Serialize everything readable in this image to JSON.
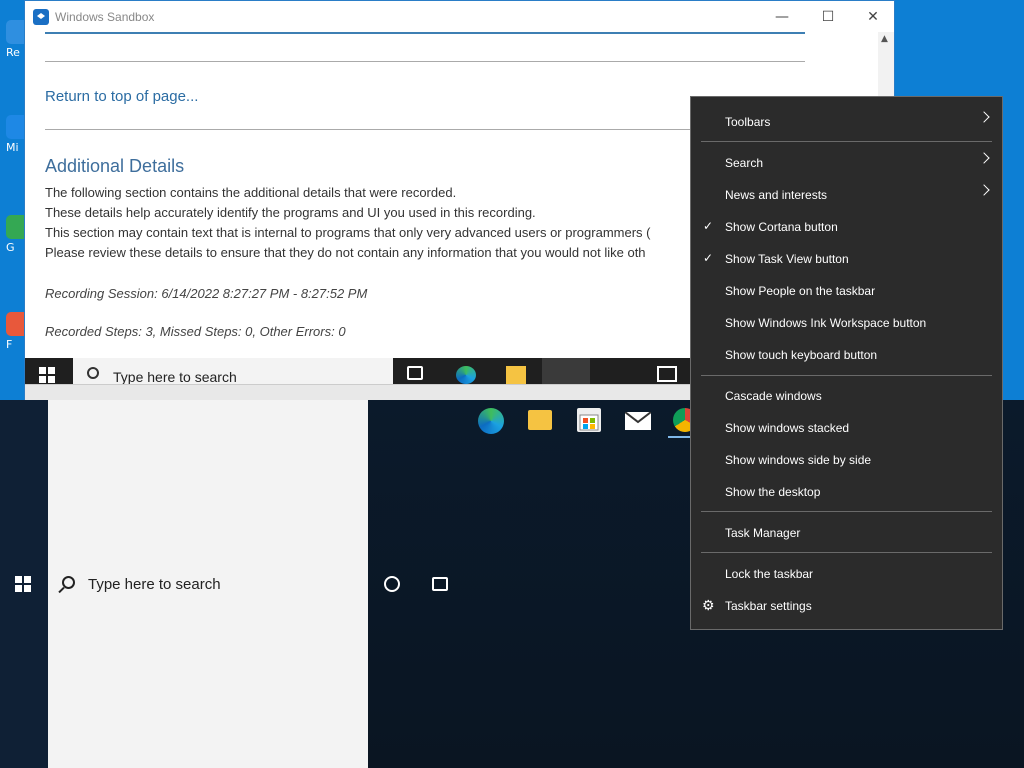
{
  "sandbox_window": {
    "title": "Windows Sandbox",
    "minimize_glyph": "—",
    "maximize_glyph": "☐",
    "close_glyph": "✕"
  },
  "document": {
    "return_link": "Return to top of page...",
    "heading": "Additional Details",
    "lines": [
      "The following section contains the additional details that were recorded.",
      "These details help accurately identify the programs and UI you used in this recording.",
      "This section may contain text that is internal to programs that only very advanced users or programmers (",
      "Please review these details to ensure that they do not contain any information that you would not like oth"
    ],
    "session": "Recording Session: 6/14/2022 8:27:27 PM - 8:27:52 PM",
    "steps": "Recorded Steps: 3, Missed Steps: 0, Other Errors: 0"
  },
  "sandbox_taskbar": {
    "search_placeholder": "Type here to search"
  },
  "taskbar": {
    "search_placeholder": "Type here to search",
    "pinned": [
      "edge-icon",
      "file-explorer-icon",
      "store-icon",
      "mail-icon",
      "chrome-icon"
    ]
  },
  "desktop_icons": [
    {
      "label": "Re",
      "color": "#2f8fe0"
    },
    {
      "label": "Mi",
      "color": "#1e88e5"
    },
    {
      "label": "G",
      "color": "#34a853"
    },
    {
      "label": "F",
      "color": "#e8583b"
    }
  ],
  "context_menu": {
    "items": [
      {
        "label": "Toolbars",
        "submenu": true,
        "checked": false
      },
      {
        "label": "Search",
        "submenu": true,
        "checked": false
      },
      {
        "label": "News and interests",
        "submenu": true,
        "checked": false
      },
      {
        "label": "Show Cortana button",
        "submenu": false,
        "checked": true
      },
      {
        "label": "Show Task View button",
        "submenu": false,
        "checked": true
      },
      {
        "label": "Show People on the taskbar",
        "submenu": false,
        "checked": false
      },
      {
        "label": "Show Windows Ink Workspace button",
        "submenu": false,
        "checked": false
      },
      {
        "label": "Show touch keyboard button",
        "submenu": false,
        "checked": false
      },
      {
        "label": "Cascade windows",
        "submenu": false,
        "checked": false
      },
      {
        "label": "Show windows stacked",
        "submenu": false,
        "checked": false
      },
      {
        "label": "Show windows side by side",
        "submenu": false,
        "checked": false
      },
      {
        "label": "Show the desktop",
        "submenu": false,
        "checked": false
      },
      {
        "label": "Task Manager",
        "submenu": false,
        "checked": false
      },
      {
        "label": "Lock the taskbar",
        "submenu": false,
        "checked": false
      },
      {
        "label": "Taskbar settings",
        "submenu": false,
        "checked": false,
        "icon": "gear-icon"
      }
    ]
  },
  "colors": {
    "menu_bg": "#2b2b2b",
    "accent_link": "#2b6ca3",
    "host_desktop": "#0d7fd4"
  }
}
